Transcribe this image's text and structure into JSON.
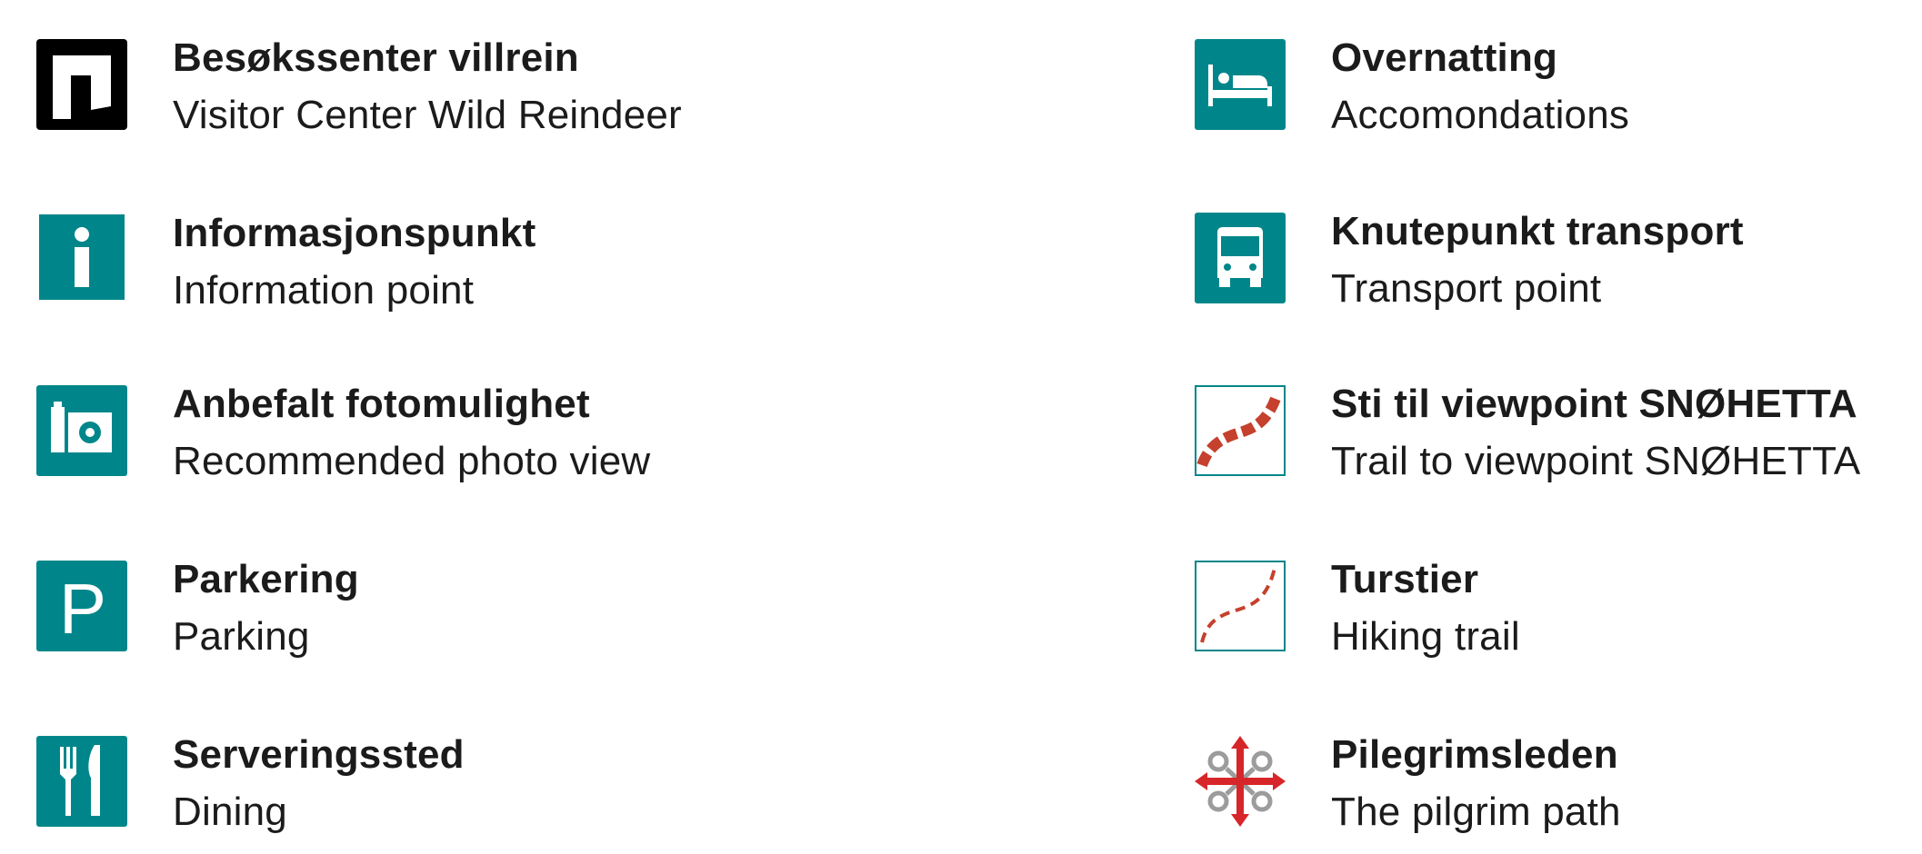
{
  "colors": {
    "teal": "#00868a",
    "black": "#000000",
    "trail_red": "#c5412d",
    "pilgrim_red": "#d7262a",
    "pilgrim_grey": "#9c9c9c",
    "text": "#1b1b1b"
  },
  "legend": {
    "left": [
      {
        "icon": "visitor-center-icon",
        "primary": "Besøkssenter villrein",
        "secondary": "Visitor Center Wild Reindeer"
      },
      {
        "icon": "info-icon",
        "primary": "Informasjonspunkt",
        "secondary": "Information point"
      },
      {
        "icon": "camera-icon",
        "primary": "Anbefalt fotomulighet",
        "secondary": "Recommended photo view"
      },
      {
        "icon": "parking-icon",
        "primary": "Parkering",
        "secondary": "Parking"
      },
      {
        "icon": "cutlery-icon",
        "primary": "Serveringssted",
        "secondary": "Dining"
      }
    ],
    "right": [
      {
        "icon": "bed-icon",
        "primary": "Overnatting",
        "secondary": "Accomondations"
      },
      {
        "icon": "bus-icon",
        "primary": "Knutepunkt transport",
        "secondary": "Transport point"
      },
      {
        "icon": "viewpoint-trail-icon",
        "primary": "Sti til viewpoint SNØHETTA",
        "secondary": "Trail to viewpoint SNØHETTA"
      },
      {
        "icon": "hiking-trail-icon",
        "primary": "Turstier",
        "secondary": "Hiking trail"
      },
      {
        "icon": "pilgrim-path-icon",
        "primary": "Pilegrimsleden",
        "secondary": "The pilgrim path"
      }
    ],
    "parking_letter": "P"
  }
}
